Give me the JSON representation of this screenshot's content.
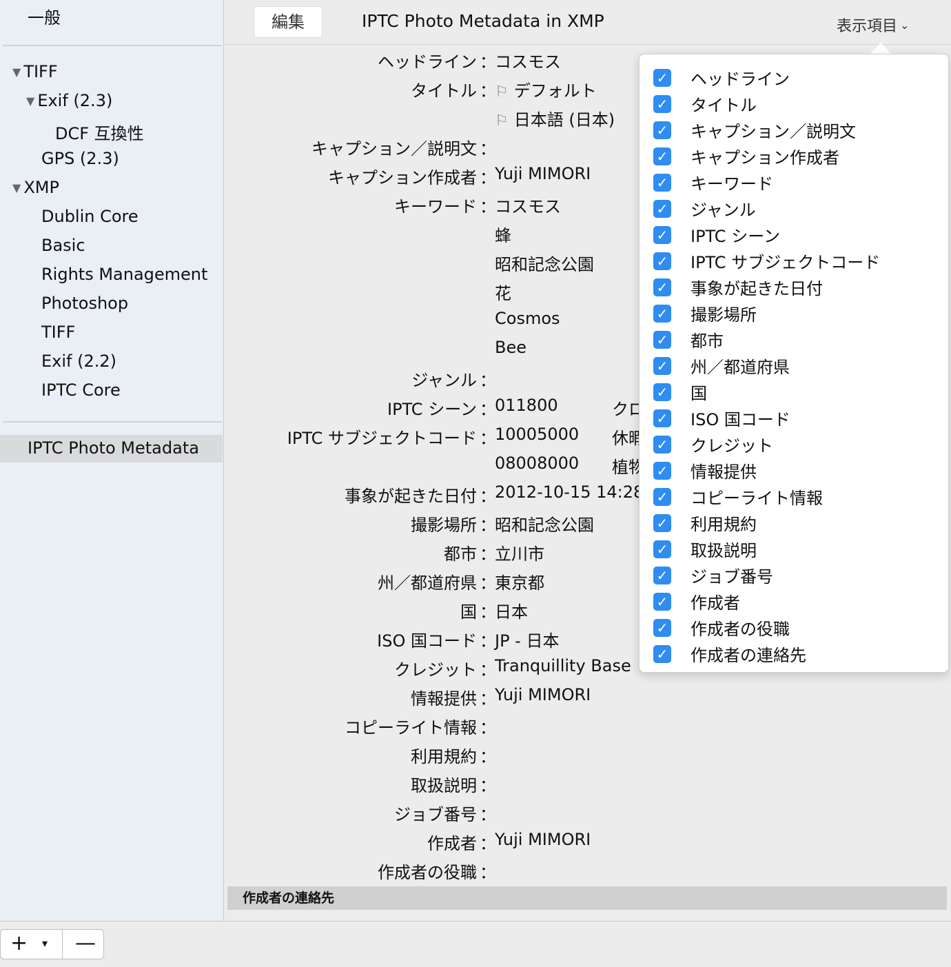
{
  "sidebar": {
    "top_item": "一般",
    "items": [
      {
        "label": "TIFF",
        "expanded": true
      },
      {
        "label": "Exif (2.3)",
        "expanded": true
      },
      {
        "label": "DCF 互換性"
      },
      {
        "label": "GPS (2.3)"
      },
      {
        "label": "XMP",
        "expanded": true
      },
      {
        "label": "Dublin Core"
      },
      {
        "label": "Basic"
      },
      {
        "label": "Rights Management"
      },
      {
        "label": "Photoshop"
      },
      {
        "label": "TIFF"
      },
      {
        "label": "Exif (2.2)"
      },
      {
        "label": "IPTC Core"
      }
    ],
    "selected": "IPTC Photo Metadata"
  },
  "header": {
    "edit_label": "編集",
    "title": "IPTC Photo Metadata in XMP",
    "display_menu": "表示項目"
  },
  "fields": [
    {
      "label": "ヘッドライン",
      "values": [
        "コスモス"
      ]
    },
    {
      "label": "タイトル",
      "values": [
        "デフォルト",
        "日本語 (日本)"
      ],
      "flagged": true
    },
    {
      "label": "キャプション／説明文",
      "values": []
    },
    {
      "label": "キャプション作成者",
      "values": [
        "Yuji MIMORI"
      ]
    },
    {
      "label": "キーワード",
      "values": [
        "コスモス",
        "蜂",
        "昭和記念公園",
        "花",
        "Cosmos",
        "Bee"
      ]
    },
    {
      "label": "ジャンル",
      "values": []
    },
    {
      "label": "IPTC シーン",
      "values": [
        "011800"
      ],
      "second": [
        "クロ"
      ]
    },
    {
      "label": "IPTC サブジェクトコード",
      "values": [
        "10005000",
        "08008000"
      ],
      "second": [
        "休暇",
        "植物"
      ]
    },
    {
      "label": "事象が起きた日付",
      "values": [
        "2012-10-15 14:28"
      ]
    },
    {
      "label": "撮影場所",
      "values": [
        "昭和記念公園"
      ]
    },
    {
      "label": "都市",
      "values": [
        "立川市"
      ]
    },
    {
      "label": "州／都道府県",
      "values": [
        "東京都"
      ]
    },
    {
      "label": "国",
      "values": [
        "日本"
      ]
    },
    {
      "label": "ISO 国コード",
      "values": [
        "JP - 日本"
      ]
    },
    {
      "label": "クレジット",
      "values": [
        "Tranquillity Base"
      ]
    },
    {
      "label": "情報提供",
      "values": [
        "Yuji MIMORI"
      ]
    },
    {
      "label": "コピーライト情報",
      "values": []
    },
    {
      "label": "利用規約",
      "values": []
    },
    {
      "label": "取扱説明",
      "values": []
    },
    {
      "label": "ジョブ番号",
      "values": []
    },
    {
      "label": "作成者",
      "values": [
        "Yuji MIMORI"
      ]
    },
    {
      "label": "作成者の役職",
      "values": []
    }
  ],
  "section_header": "作成者の連絡先",
  "popover": {
    "items": [
      "ヘッドライン",
      "タイトル",
      "キャプション／説明文",
      "キャプション作成者",
      "キーワード",
      "ジャンル",
      "IPTC シーン",
      "IPTC サブジェクトコード",
      "事象が起きた日付",
      "撮影場所",
      "都市",
      "州／都道府県",
      "国",
      "ISO 国コード",
      "クレジット",
      "情報提供",
      "コピーライト情報",
      "利用規約",
      "取扱説明",
      "ジョブ番号",
      "作成者",
      "作成者の役職",
      "作成者の連絡先"
    ],
    "accent": "#2f8cf0"
  },
  "bottombar": {
    "plus": "+",
    "caret": "▾",
    "minus": "—"
  },
  "colors": {
    "sidebar_bg": "#eaeef5",
    "selected_bg": "#d9dadc",
    "accent": "#2f8cf0"
  }
}
